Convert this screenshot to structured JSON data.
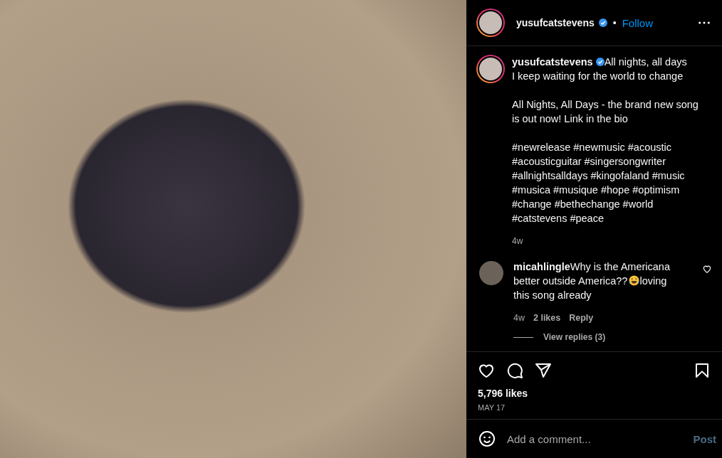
{
  "header": {
    "username": "yusufcatstevens",
    "verified": true,
    "separator": "•",
    "follow": "Follow"
  },
  "caption": {
    "username": "yusufcatstevens",
    "verified": true,
    "text": "All nights, all days\nI keep waiting for the world to change\n\nAll Nights, All Days - the brand new song is out now! Link in the bio",
    "hashtags": "#newrelease #newmusic #acoustic #acousticguitar #singersongwriter #allnightsalldays #kingofaland #music #musica #musique #hope #optimism #change #bethechange #world #catstevens #peace",
    "time": "4w"
  },
  "comments": [
    {
      "username": "micahlingle",
      "text": "Why is the Americana better outside America??",
      "text_after_emoji": "loving this song already",
      "time": "4w",
      "likes": "2 likes",
      "reply": "Reply",
      "liked": false,
      "view_replies": "View replies (3)"
    }
  ],
  "actions": {
    "liked": false,
    "saved": false,
    "likes": "5,796 likes",
    "date": "MAY 17"
  },
  "add_comment": {
    "placeholder": "Add a comment...",
    "post": "Post"
  }
}
